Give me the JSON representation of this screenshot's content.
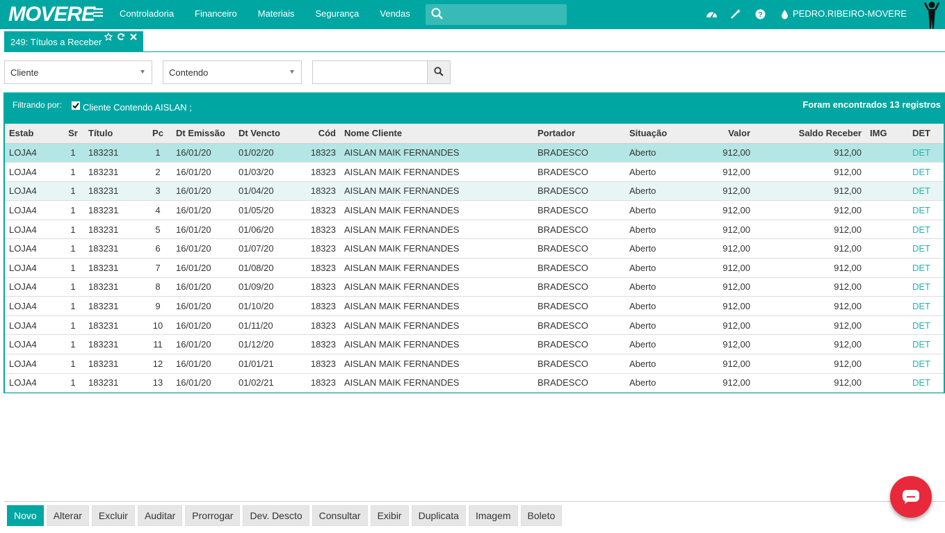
{
  "brand": {
    "logo_text": "MOVERE"
  },
  "nav": {
    "items": [
      "Controladoria",
      "Financeiro",
      "Materiais",
      "Segurança",
      "Vendas"
    ],
    "search_placeholder": "",
    "user": "PEDRO.RIBEIRO-MOVERE"
  },
  "tab": {
    "label": "249: Títulos a Receber"
  },
  "filters": {
    "field": "Cliente",
    "operator": "Contendo",
    "value": ""
  },
  "panel": {
    "filter_label": "Filtrando por:",
    "filter_text": "Cliente Contendo AISLAN ;",
    "count_text": "Foram encontrados 13 registros"
  },
  "columns": [
    "Estab",
    "Sr",
    "Título",
    "Pc",
    "Dt Emissão",
    "Dt Vencto",
    "Cód",
    "Nome Cliente",
    "Portador",
    "Situação",
    "Valor",
    "Saldo Receber",
    "IMG",
    "DET"
  ],
  "rows": [
    [
      "LOJA4",
      "1",
      "183231",
      "1",
      "16/01/20",
      "01/02/20",
      "18323",
      "AISLAN MAIK FERNANDES",
      "BRADESCO",
      "Aberto",
      "912,00",
      "912,00",
      "",
      "DET"
    ],
    [
      "LOJA4",
      "1",
      "183231",
      "2",
      "16/01/20",
      "01/03/20",
      "18323",
      "AISLAN MAIK FERNANDES",
      "BRADESCO",
      "Aberto",
      "912,00",
      "912,00",
      "",
      "DET"
    ],
    [
      "LOJA4",
      "1",
      "183231",
      "3",
      "16/01/20",
      "01/04/20",
      "18323",
      "AISLAN MAIK FERNANDES",
      "BRADESCO",
      "Aberto",
      "912,00",
      "912,00",
      "",
      "DET"
    ],
    [
      "LOJA4",
      "1",
      "183231",
      "4",
      "16/01/20",
      "01/05/20",
      "18323",
      "AISLAN MAIK FERNANDES",
      "BRADESCO",
      "Aberto",
      "912,00",
      "912,00",
      "",
      "DET"
    ],
    [
      "LOJA4",
      "1",
      "183231",
      "5",
      "16/01/20",
      "01/06/20",
      "18323",
      "AISLAN MAIK FERNANDES",
      "BRADESCO",
      "Aberto",
      "912,00",
      "912,00",
      "",
      "DET"
    ],
    [
      "LOJA4",
      "1",
      "183231",
      "6",
      "16/01/20",
      "01/07/20",
      "18323",
      "AISLAN MAIK FERNANDES",
      "BRADESCO",
      "Aberto",
      "912,00",
      "912,00",
      "",
      "DET"
    ],
    [
      "LOJA4",
      "1",
      "183231",
      "7",
      "16/01/20",
      "01/08/20",
      "18323",
      "AISLAN MAIK FERNANDES",
      "BRADESCO",
      "Aberto",
      "912,00",
      "912,00",
      "",
      "DET"
    ],
    [
      "LOJA4",
      "1",
      "183231",
      "8",
      "16/01/20",
      "01/09/20",
      "18323",
      "AISLAN MAIK FERNANDES",
      "BRADESCO",
      "Aberto",
      "912,00",
      "912,00",
      "",
      "DET"
    ],
    [
      "LOJA4",
      "1",
      "183231",
      "9",
      "16/01/20",
      "01/10/20",
      "18323",
      "AISLAN MAIK FERNANDES",
      "BRADESCO",
      "Aberto",
      "912,00",
      "912,00",
      "",
      "DET"
    ],
    [
      "LOJA4",
      "1",
      "183231",
      "10",
      "16/01/20",
      "01/11/20",
      "18323",
      "AISLAN MAIK FERNANDES",
      "BRADESCO",
      "Aberto",
      "912,00",
      "912,00",
      "",
      "DET"
    ],
    [
      "LOJA4",
      "1",
      "183231",
      "11",
      "16/01/20",
      "01/12/20",
      "18323",
      "AISLAN MAIK FERNANDES",
      "BRADESCO",
      "Aberto",
      "912,00",
      "912,00",
      "",
      "DET"
    ],
    [
      "LOJA4",
      "1",
      "183231",
      "12",
      "16/01/20",
      "01/01/21",
      "18323",
      "AISLAN MAIK FERNANDES",
      "BRADESCO",
      "Aberto",
      "912,00",
      "912,00",
      "",
      "DET"
    ],
    [
      "LOJA4",
      "1",
      "183231",
      "13",
      "16/01/20",
      "01/02/21",
      "18323",
      "AISLAN MAIK FERNANDES",
      "BRADESCO",
      "Aberto",
      "912,00",
      "912,00",
      "",
      "DET"
    ]
  ],
  "selected_row": 0,
  "hover_row": 2,
  "toolbar": [
    "Novo",
    "Alterar",
    "Excluir",
    "Auditar",
    "Prorrogar",
    "Dev. Descto",
    "Consultar",
    "Exibir",
    "Duplicata",
    "Imagem",
    "Boleto"
  ],
  "colors": {
    "accent": "#00a7a2",
    "selected_row": "#b3e6e5",
    "link": "#1fb3ad",
    "chat": "#e8293b"
  },
  "icons": [
    "hamburger-icon",
    "search-icon",
    "dashboard-icon",
    "magic-wand-icon",
    "help-icon",
    "drop-icon",
    "user-avatar-icon",
    "star-icon",
    "refresh-icon",
    "close-icon",
    "chat-icon"
  ]
}
